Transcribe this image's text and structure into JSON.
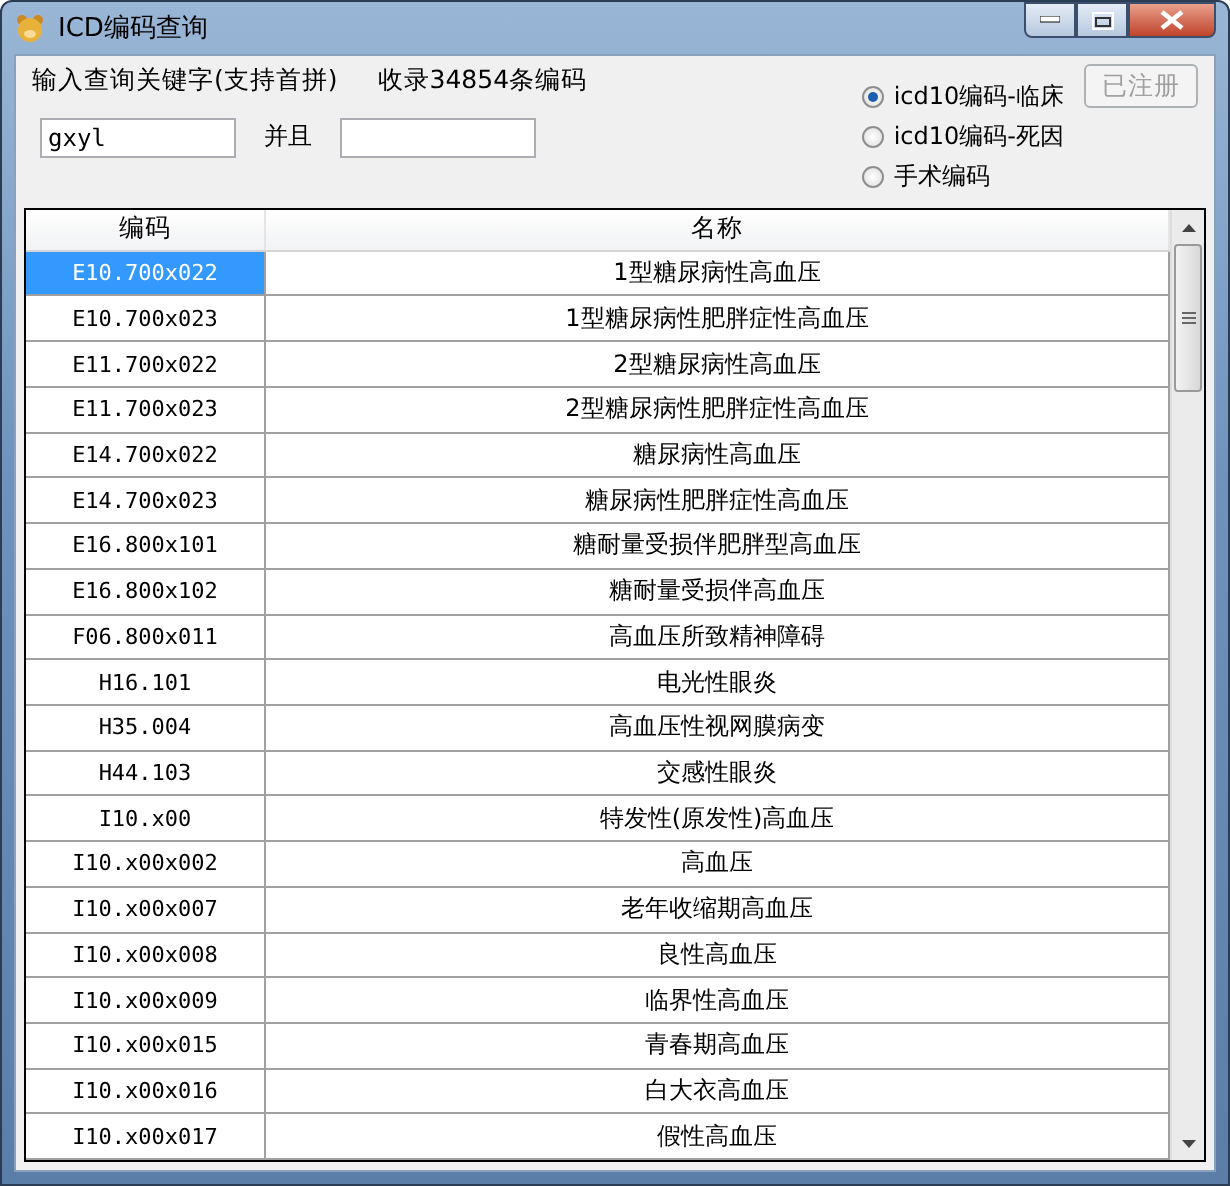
{
  "window": {
    "title": "ICD编码查询"
  },
  "search": {
    "label": "输入查询关键字(支持首拼)",
    "count_text": "收录34854条编码",
    "keyword_value": "gxyl",
    "and_label": "并且"
  },
  "modes": [
    {
      "label": "icd10编码-临床",
      "selected": true
    },
    {
      "label": "icd10编码-死因",
      "selected": false
    },
    {
      "label": "手术编码",
      "selected": false
    }
  ],
  "register_button": {
    "label": "已注册",
    "disabled": true
  },
  "table": {
    "columns": [
      "编码",
      "名称"
    ],
    "rows": [
      {
        "code": "E10.700x022",
        "name": "1型糖尿病性高血压",
        "selected": true
      },
      {
        "code": "E10.700x023",
        "name": "1型糖尿病性肥胖症性高血压",
        "selected": false
      },
      {
        "code": "E11.700x022",
        "name": "2型糖尿病性高血压",
        "selected": false
      },
      {
        "code": "E11.700x023",
        "name": "2型糖尿病性肥胖症性高血压",
        "selected": false
      },
      {
        "code": "E14.700x022",
        "name": "糖尿病性高血压",
        "selected": false
      },
      {
        "code": "E14.700x023",
        "name": "糖尿病性肥胖症性高血压",
        "selected": false
      },
      {
        "code": "E16.800x101",
        "name": "糖耐量受损伴肥胖型高血压",
        "selected": false
      },
      {
        "code": "E16.800x102",
        "name": "糖耐量受损伴高血压",
        "selected": false
      },
      {
        "code": "F06.800x011",
        "name": "高血压所致精神障碍",
        "selected": false
      },
      {
        "code": "H16.101",
        "name": "电光性眼炎",
        "selected": false
      },
      {
        "code": "H35.004",
        "name": "高血压性视网膜病变",
        "selected": false
      },
      {
        "code": "H44.103",
        "name": "交感性眼炎",
        "selected": false
      },
      {
        "code": "I10.x00",
        "name": "特发性(原发性)高血压",
        "selected": false
      },
      {
        "code": "I10.x00x002",
        "name": "高血压",
        "selected": false
      },
      {
        "code": "I10.x00x007",
        "name": "老年收缩期高血压",
        "selected": false
      },
      {
        "code": "I10.x00x008",
        "name": "良性高血压",
        "selected": false
      },
      {
        "code": "I10.x00x009",
        "name": "临界性高血压",
        "selected": false
      },
      {
        "code": "I10.x00x015",
        "name": "青春期高血压",
        "selected": false
      },
      {
        "code": "I10.x00x016",
        "name": "白大衣高血压",
        "selected": false
      },
      {
        "code": "I10.x00x017",
        "name": "假性高血压",
        "selected": false
      }
    ]
  }
}
